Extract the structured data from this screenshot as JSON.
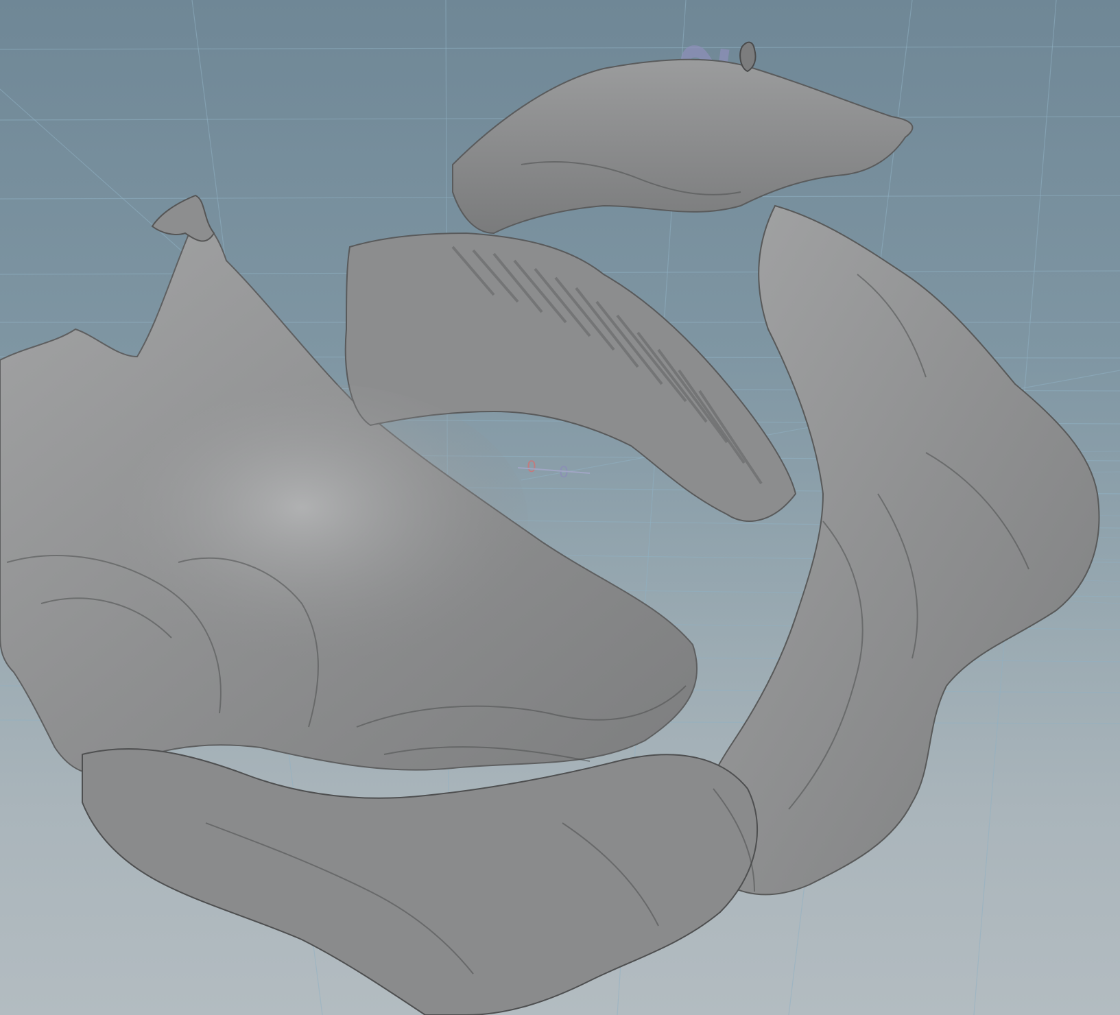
{
  "viewport": {
    "axis_labels": {
      "z": "2",
      "y": "1",
      "origin_a": "0",
      "origin_b": "0"
    },
    "colors": {
      "sky_top": "#6f8796",
      "sky_bottom": "#b3bcc1",
      "grid_line": "#8fb0c2",
      "mesh_base": "#8e8f90",
      "mesh_highlight": "#b5b6b7",
      "mesh_shadow": "#4a4b4c"
    }
  }
}
